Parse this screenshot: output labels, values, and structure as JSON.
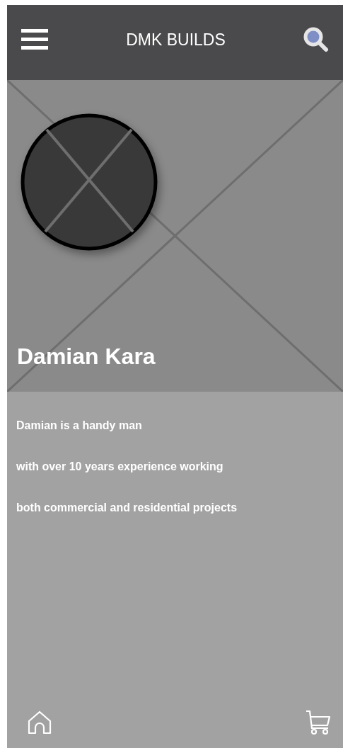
{
  "header": {
    "title": "DMK BUILDS"
  },
  "profile": {
    "name": "Damian Kara"
  },
  "bio": [
    "Damian is a handy man",
    "with over 10 years experience working",
    "both commercial and residential projects"
  ]
}
